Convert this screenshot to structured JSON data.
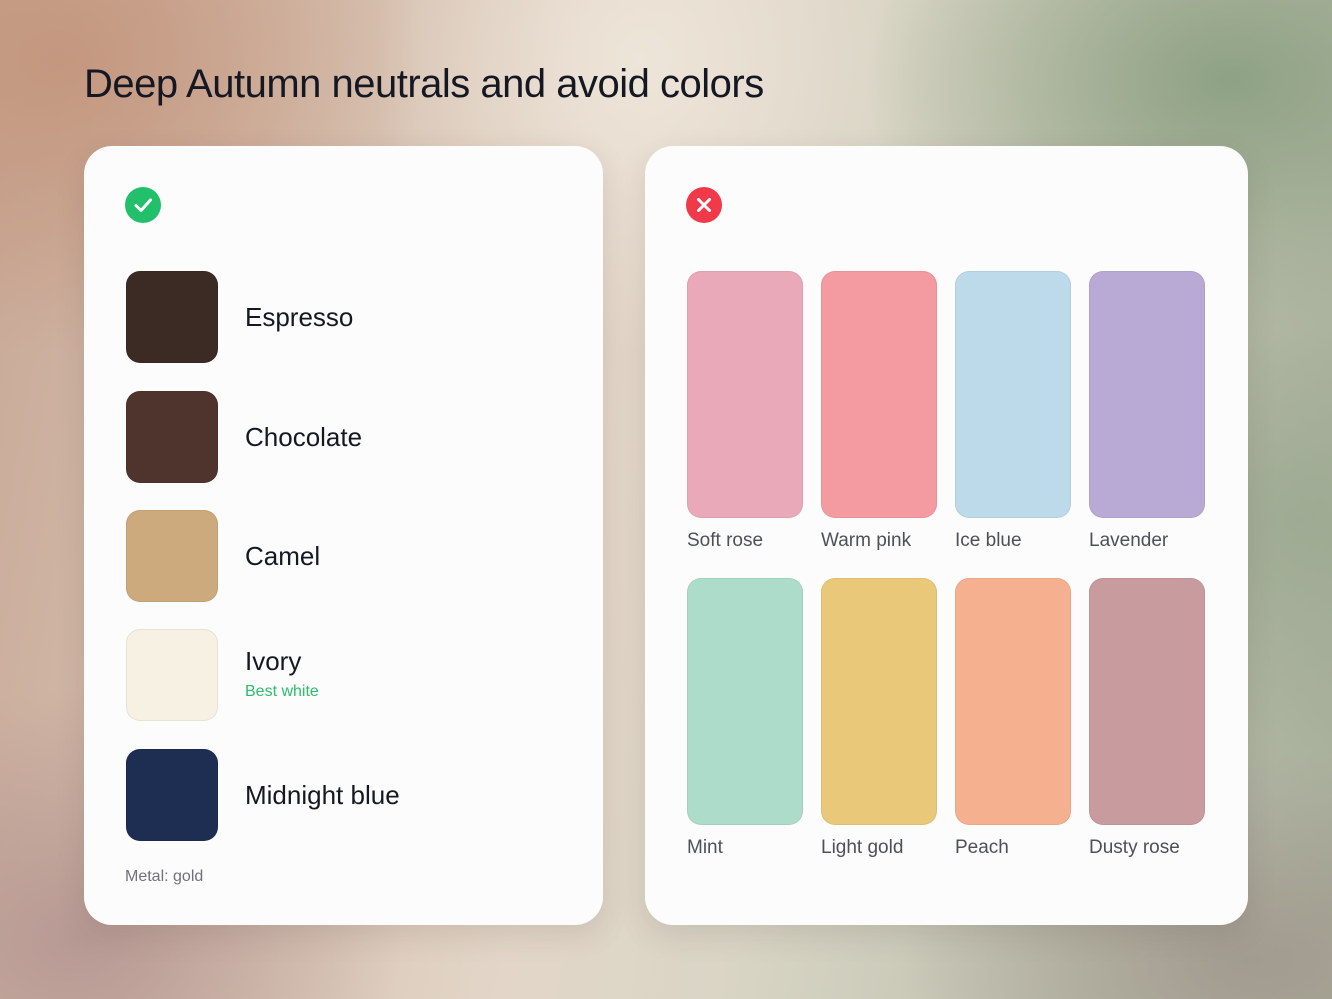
{
  "page": {
    "title": "Deep Autumn neutrals and avoid colors"
  },
  "best_panel": {
    "status_icon": "check-icon",
    "status_color": "#22c06a",
    "colors": [
      {
        "name": "Espresso",
        "swatch": "#3c2b24",
        "note": ""
      },
      {
        "name": "Chocolate",
        "swatch": "#4f332d",
        "note": ""
      },
      {
        "name": "Camel",
        "swatch": "#cdaa7d",
        "note": ""
      },
      {
        "name": "Ivory",
        "swatch": "#f6f1e2",
        "note": "Best white"
      },
      {
        "name": "Midnight blue",
        "swatch": "#1e2d52",
        "note": ""
      }
    ],
    "metal": "Metal: gold"
  },
  "avoid_panel": {
    "status_icon": "close-icon",
    "status_color": "#f03a4a",
    "colors": [
      {
        "name": "Soft rose",
        "swatch": "#eaa9b8"
      },
      {
        "name": "Warm pink",
        "swatch": "#f49aa1"
      },
      {
        "name": "Ice blue",
        "swatch": "#bcdaea"
      },
      {
        "name": "Lavender",
        "swatch": "#b9a9d5"
      },
      {
        "name": "Mint",
        "swatch": "#aedccb"
      },
      {
        "name": "Light gold",
        "swatch": "#e9c87a"
      },
      {
        "name": "Peach",
        "swatch": "#f5b08f"
      },
      {
        "name": "Dusty rose",
        "swatch": "#c89b9f"
      }
    ]
  }
}
